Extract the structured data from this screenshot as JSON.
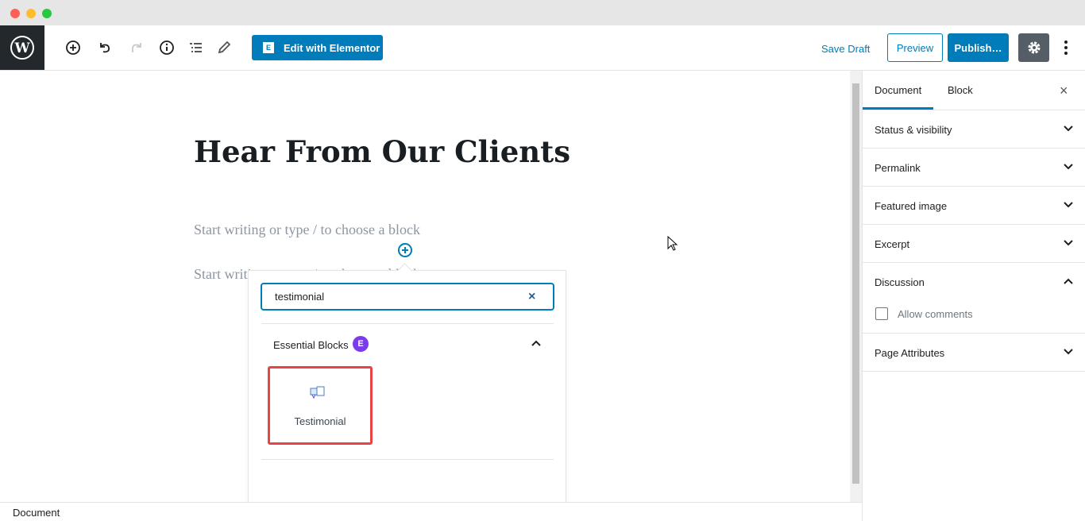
{
  "toolbar": {
    "edit_elementor": "Edit with Elementor",
    "elementor_icon": "E",
    "save_draft": "Save Draft",
    "preview": "Preview",
    "publish": "Publish…"
  },
  "editor": {
    "title": "Hear From Our Clients",
    "placeholder_1": "Start writing or type / to choose a block",
    "placeholder_2": "Start writing or type / to choose a block"
  },
  "inserter": {
    "search_value": "testimonial",
    "category": "Essential Blocks",
    "category_badge": "E",
    "blocks": [
      {
        "label": "Testimonial"
      }
    ]
  },
  "sidebar": {
    "tabs": [
      "Document",
      "Block"
    ],
    "close": "×",
    "panels": [
      "Status & visibility",
      "Permalink",
      "Featured image",
      "Excerpt",
      "Discussion",
      "Page Attributes"
    ],
    "allow_comments": "Allow comments"
  },
  "footer": {
    "breadcrumb": "Document"
  },
  "colors": {
    "accent": "#007cba",
    "highlight": "#e94343",
    "badge": "#7c3aed"
  }
}
